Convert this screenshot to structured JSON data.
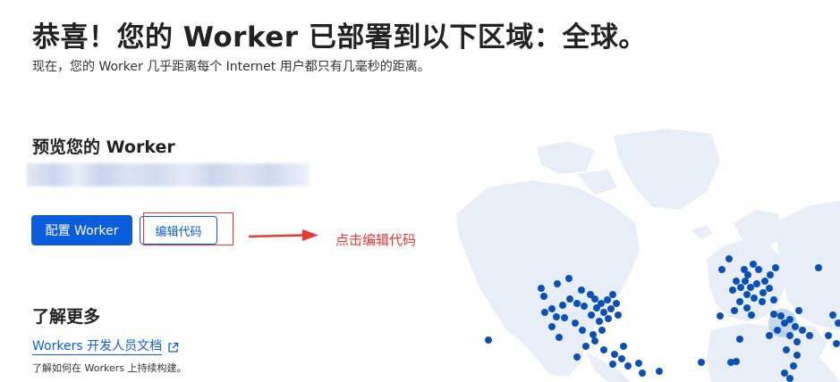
{
  "header": {
    "title": "恭喜！您的 Worker 已部署到以下区域：全球。",
    "subtitle": "现在，您的 Worker 几乎距离每个 Internet 用户都只有几毫秒的距离。"
  },
  "preview": {
    "heading": "预览您的 Worker",
    "configure_button": "配置 Worker",
    "edit_code_button": "编辑代码"
  },
  "annotation": {
    "text": "点击编辑代码",
    "color": "#e53935"
  },
  "learn_more": {
    "heading": "了解更多",
    "docs_link": "Workers 开发人员文档",
    "docs_description": "了解如何在 Workers 上持续构建。"
  },
  "colors": {
    "primary": "#0a5ddc",
    "map_land": "#e8eef8",
    "map_dot": "#0b4fb8"
  },
  "icons": {
    "external_link": "external-link-icon"
  }
}
